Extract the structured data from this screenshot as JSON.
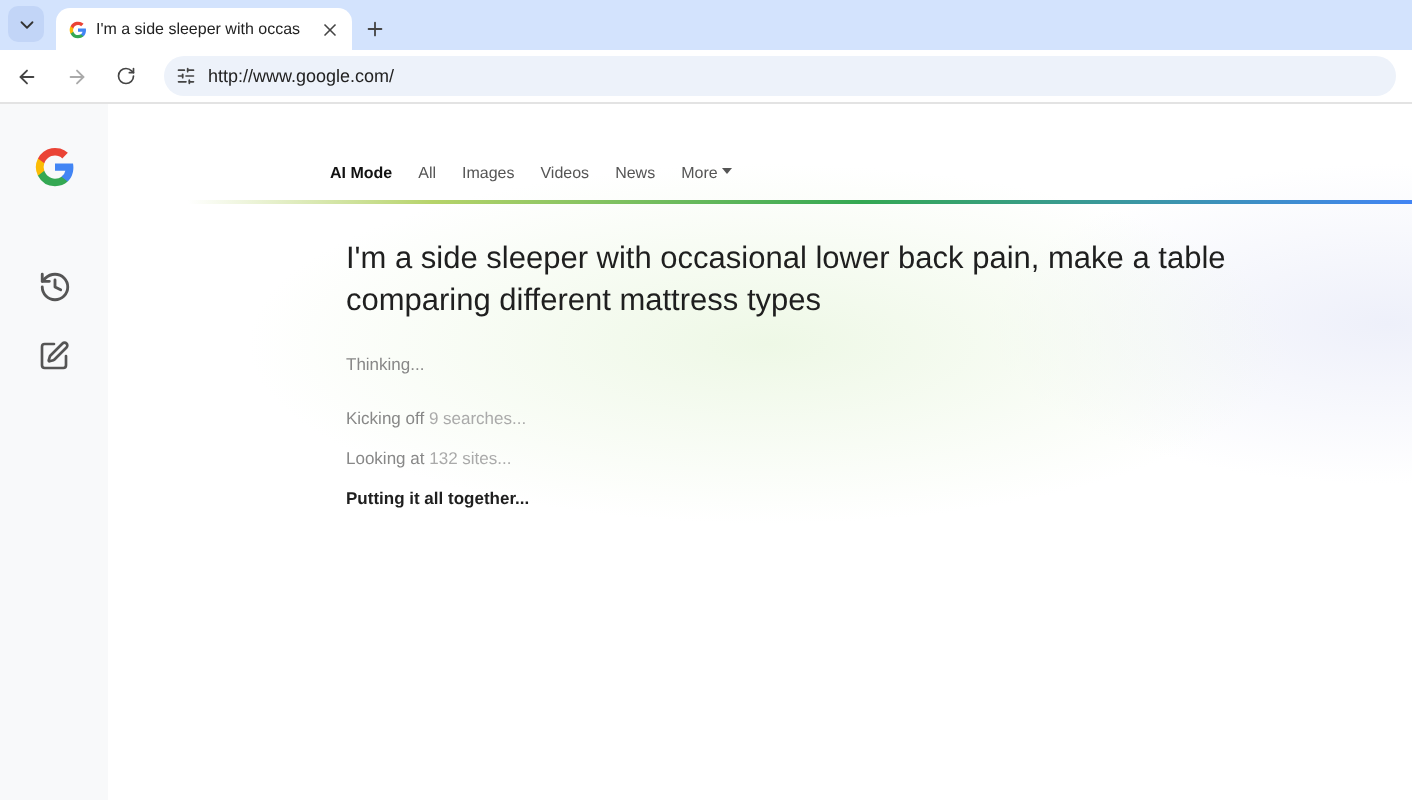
{
  "browser": {
    "tab": {
      "title": "I'm a side sleeper with occas",
      "selected": true
    },
    "address": "http://www.google.com/"
  },
  "nav": [
    {
      "label": "AI Mode",
      "selected": true
    },
    {
      "label": "All",
      "selected": false
    },
    {
      "label": "Images",
      "selected": false
    },
    {
      "label": "Videos",
      "selected": false
    },
    {
      "label": "News",
      "selected": false
    },
    {
      "label": "More",
      "selected": false,
      "kind": "menu"
    }
  ],
  "query": "I'm a side sleeper with occasional lower back pain, make a table comparing different mattress types",
  "status": "Thinking...",
  "steps": [
    {
      "text": "Kicking off",
      "detail": "9 searches...",
      "kind": "done"
    },
    {
      "text": "Looking at",
      "detail": "132 sites...",
      "kind": "done"
    },
    {
      "text": "Putting it all together...",
      "kind": "current"
    }
  ]
}
